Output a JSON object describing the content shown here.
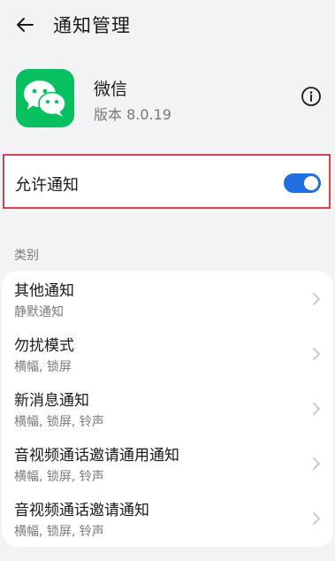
{
  "header": {
    "title": "通知管理",
    "back_icon": "back-arrow-icon"
  },
  "app": {
    "name": "微信",
    "version": "版本 8.0.19",
    "icon": "wechat-icon",
    "icon_color": "#07c160"
  },
  "allow": {
    "label": "允许通知",
    "enabled": true,
    "toggle_color": "#1f6fe0"
  },
  "categories": {
    "label": "类别",
    "items": [
      {
        "title": "其他通知",
        "subtitle": "静默通知"
      },
      {
        "title": "勿扰模式",
        "subtitle": "横幅, 锁屏"
      },
      {
        "title": "新消息通知",
        "subtitle": "横幅, 锁屏, 铃声"
      },
      {
        "title": "音视频通话邀请通用通知",
        "subtitle": "横幅, 锁屏, 铃声"
      },
      {
        "title": "音视频通话邀请通知",
        "subtitle": "横幅, 锁屏, 铃声"
      }
    ]
  }
}
